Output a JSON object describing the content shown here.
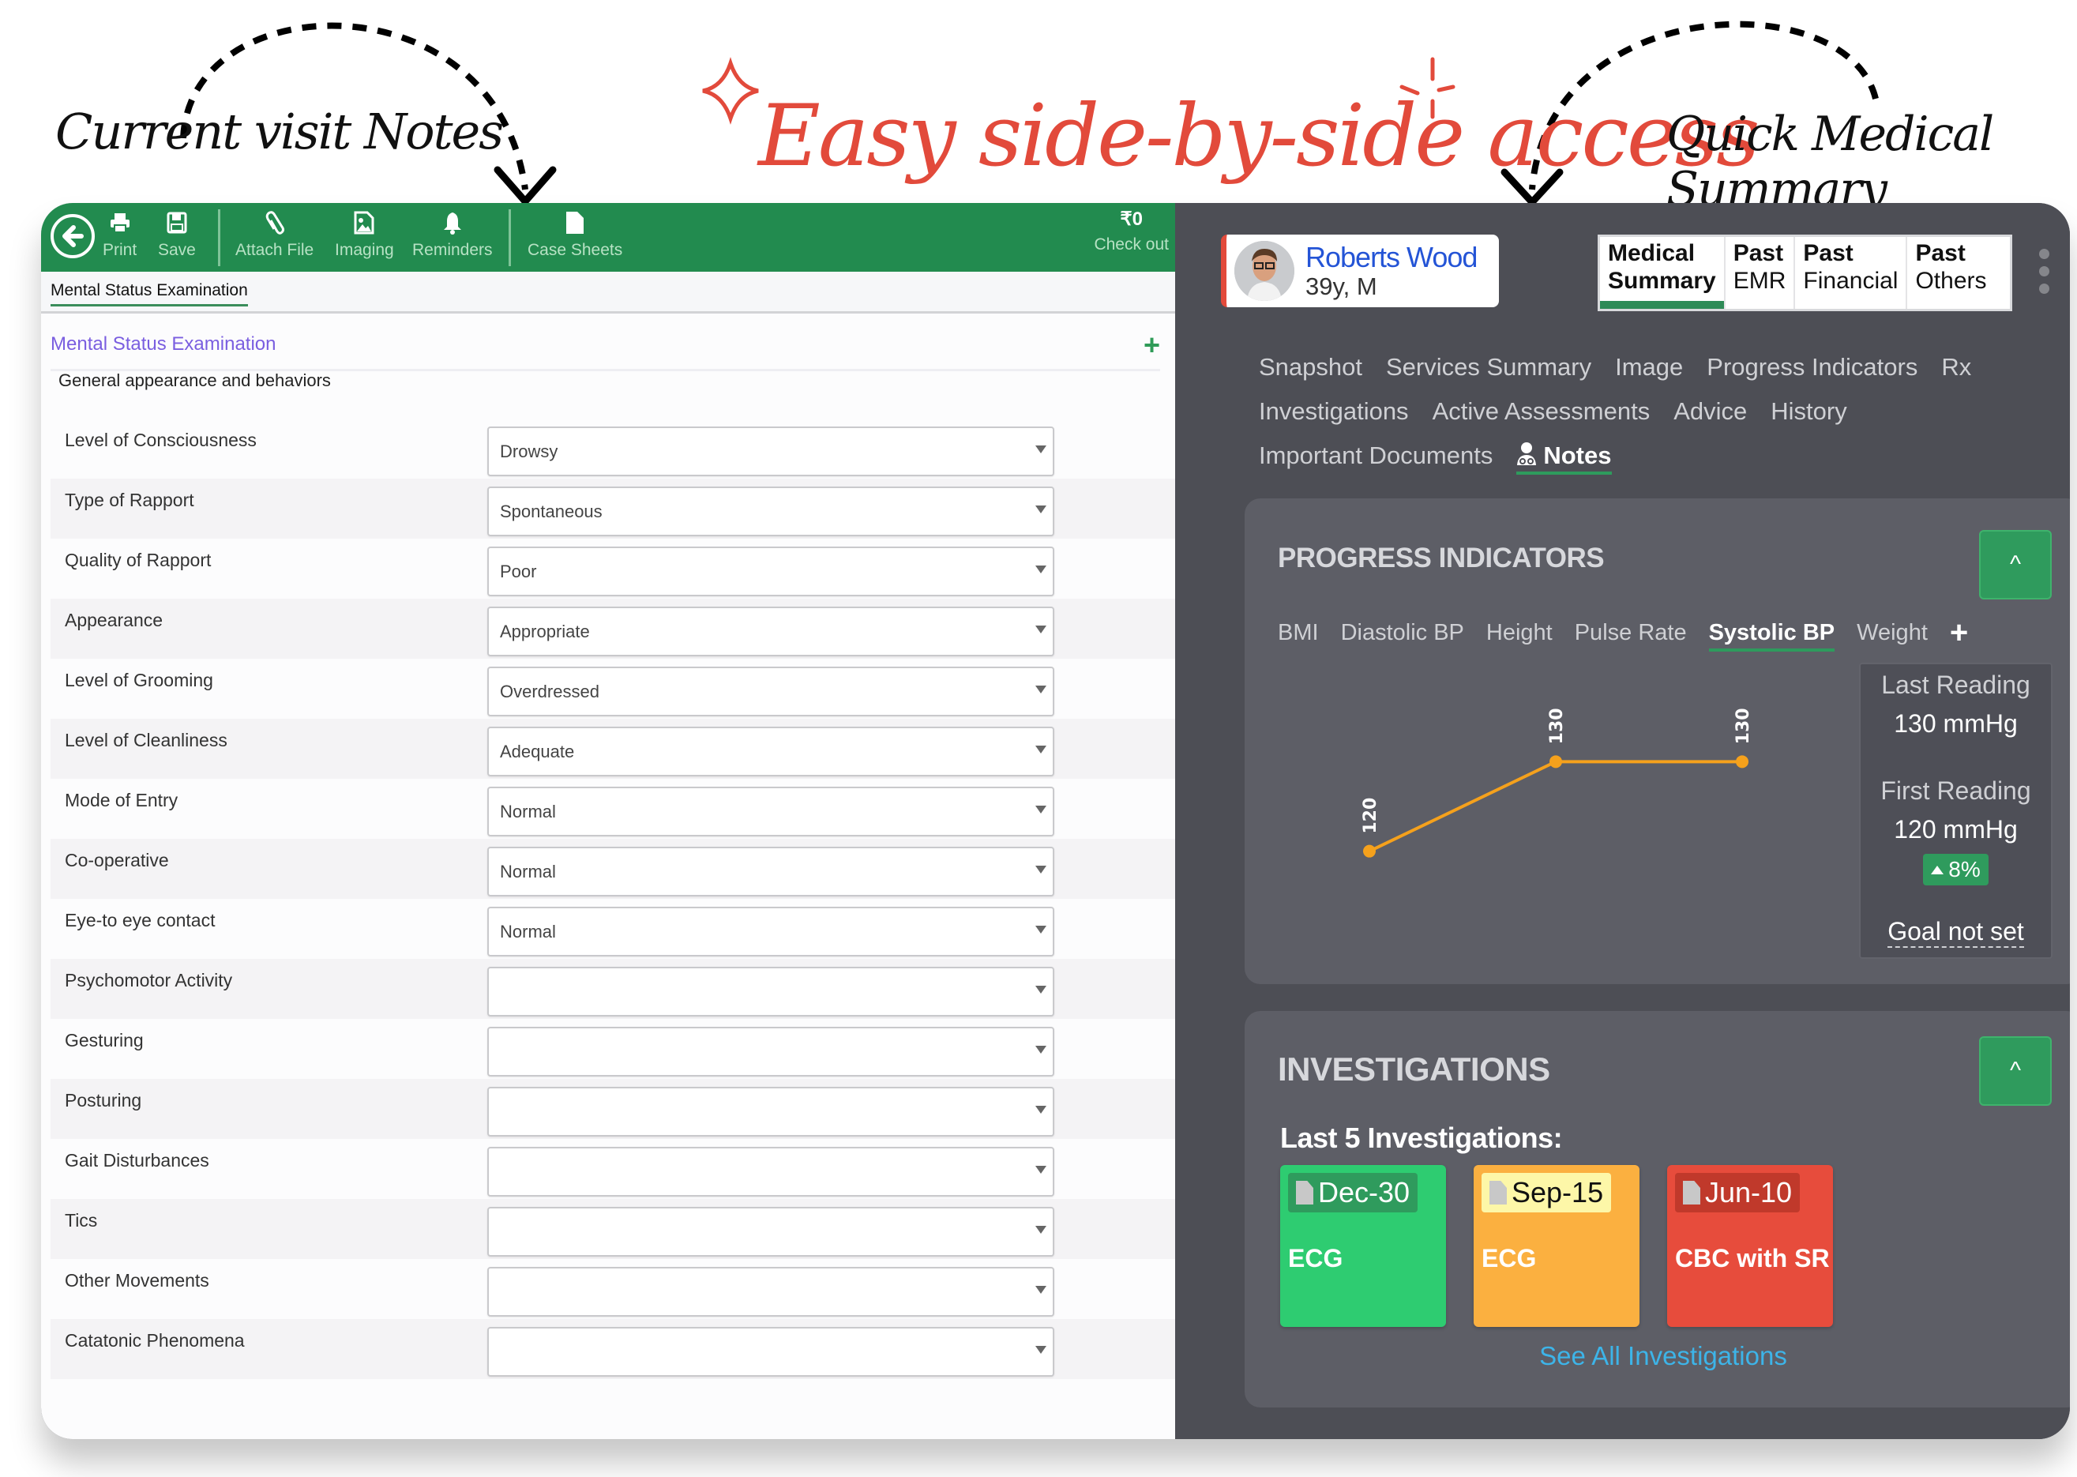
{
  "annotations": {
    "left_label": "Current visit Notes",
    "headline": "Easy side-by-side access",
    "right_label": "Quick Medical Summary"
  },
  "toolbar": {
    "items": [
      {
        "label": "Print",
        "icon": "print-icon"
      },
      {
        "label": "Save",
        "icon": "save-icon"
      },
      {
        "label": "Attach File",
        "icon": "paperclip-icon"
      },
      {
        "label": "Imaging",
        "icon": "image-file-icon"
      },
      {
        "label": "Reminders",
        "icon": "bell-icon"
      },
      {
        "label": "Case Sheets",
        "icon": "document-icon"
      }
    ],
    "checkout_amount": "₹0",
    "checkout_label": "Check out"
  },
  "notes": {
    "active_tab": "Mental Status Examination",
    "section_title": "Mental Status Examination",
    "group_title": "General appearance and behaviors",
    "fields": [
      {
        "label": "Level of Consciousness",
        "value": "Drowsy"
      },
      {
        "label": "Type of Rapport",
        "value": "Spontaneous"
      },
      {
        "label": "Quality of Rapport",
        "value": "Poor"
      },
      {
        "label": "Appearance",
        "value": "Appropriate"
      },
      {
        "label": "Level of Grooming",
        "value": "Overdressed"
      },
      {
        "label": "Level of Cleanliness",
        "value": "Adequate"
      },
      {
        "label": "Mode of Entry",
        "value": "Normal"
      },
      {
        "label": "Co-operative",
        "value": "Normal"
      },
      {
        "label": "Eye-to eye contact",
        "value": "Normal"
      },
      {
        "label": "Psychomotor Activity",
        "value": ""
      },
      {
        "label": "Gesturing",
        "value": ""
      },
      {
        "label": "Posturing",
        "value": ""
      },
      {
        "label": "Gait Disturbances",
        "value": ""
      },
      {
        "label": "Tics",
        "value": ""
      },
      {
        "label": "Other Movements",
        "value": ""
      },
      {
        "label": "Catatonic Phenomena",
        "value": ""
      }
    ]
  },
  "patient": {
    "name": "Roberts Wood",
    "meta": "39y, M"
  },
  "summary_tabs": [
    {
      "line1": "Medical",
      "line2": "Summary",
      "active": true
    },
    {
      "line1": "Past",
      "line2": "EMR",
      "active": false
    },
    {
      "line1": "Past",
      "line2": "Financial",
      "active": false
    },
    {
      "line1": "Past",
      "line2": "Others",
      "active": false
    }
  ],
  "nav_lines": [
    [
      "Snapshot",
      "Services Summary",
      "Image",
      "Progress Indicators",
      "Rx"
    ],
    [
      "Investigations",
      "Active Assessments",
      "Advice",
      "History"
    ],
    [
      "Important Documents",
      "Notes"
    ]
  ],
  "nav_active": "Notes",
  "progress": {
    "title": "PROGRESS INDICATORS",
    "tabs": [
      "BMI",
      "Diastolic BP",
      "Height",
      "Pulse Rate",
      "Systolic BP",
      "Weight"
    ],
    "active_tab": "Systolic BP",
    "last_reading_label": "Last Reading",
    "last_reading_value": "130 mmHg",
    "first_reading_label": "First Reading",
    "first_reading_value": "120 mmHg",
    "change_badge": "8%",
    "goal_label": "Goal not set"
  },
  "chart_data": {
    "type": "line",
    "title": "Systolic BP",
    "x": [
      1,
      2,
      3
    ],
    "values": [
      120,
      130,
      130
    ],
    "data_labels": [
      "120",
      "130",
      "130"
    ],
    "xlabel": "",
    "ylabel": "",
    "ylim": [
      110,
      140
    ],
    "grid": false,
    "color": "#f5a11c"
  },
  "investigations": {
    "title": "INVESTIGATIONS",
    "subtitle": "Last 5 Investigations:",
    "items": [
      {
        "date": "Dec-30",
        "name": "ECG",
        "bg": "#2ecc71",
        "date_bg": "#2f9b5d",
        "date_color": "#ffffff"
      },
      {
        "date": "Sep-15",
        "name": "ECG",
        "bg": "#fbb040",
        "date_bg": "#fdf7a8",
        "date_color": "#111111"
      },
      {
        "date": "Jun-10",
        "name": "CBC with SR",
        "bg": "#e74c3c",
        "date_bg": "#c0392b",
        "date_color": "#ffffff"
      }
    ],
    "see_all": "See All Investigations"
  },
  "colors": {
    "toolbar_green": "#228b4f",
    "accent_green": "#2e9b5d",
    "section_purple": "#7a5ee0",
    "patient_blue": "#2454d6",
    "link_blue": "#3db4e8",
    "headline_red": "#e24a3b"
  }
}
